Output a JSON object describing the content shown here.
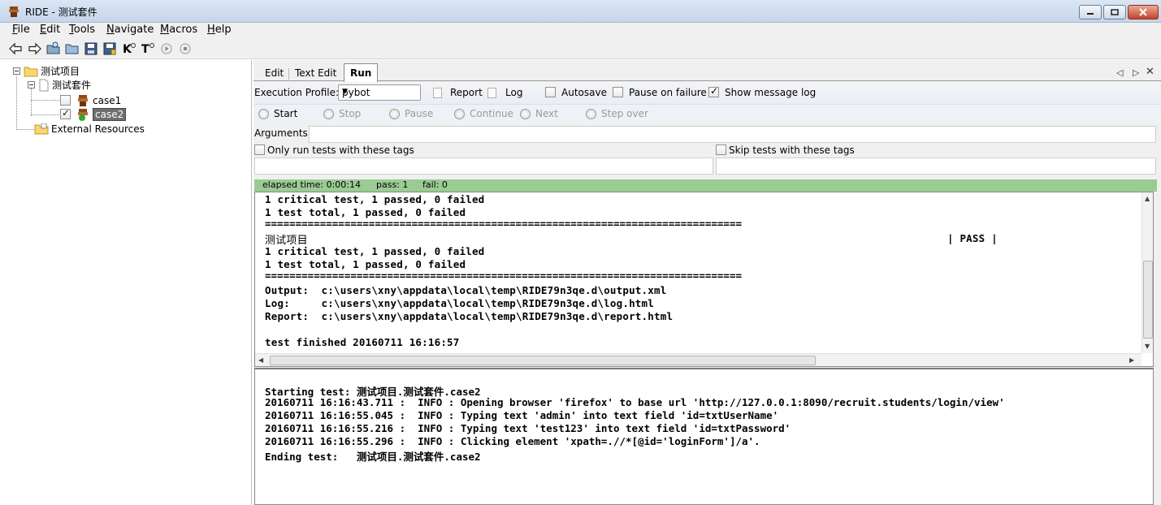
{
  "window": {
    "title": "RIDE - 测试套件",
    "icons": [
      "ride-app-icon",
      "minimize-icon",
      "maximize-icon",
      "close-icon"
    ]
  },
  "menu": [
    {
      "label": "File",
      "mnemonic": "F",
      "rest": "ile"
    },
    {
      "label": "Edit",
      "mnemonic": "E",
      "rest": "dit"
    },
    {
      "label": "Tools",
      "mnemonic": "T",
      "rest": "ools"
    },
    {
      "label": "Navigate",
      "mnemonic": "N",
      "rest": "avigate"
    },
    {
      "label": "Macros",
      "mnemonic": "M",
      "rest": "acros"
    },
    {
      "label": "Help",
      "mnemonic": "H",
      "rest": "elp"
    }
  ],
  "toolbar_icons": [
    "back-arrow-icon",
    "forward-arrow-icon",
    "open-suite-icon",
    "open-directory-icon",
    "save-icon",
    "save-all-icon",
    "search-keywords-icon",
    "search-tests-icon",
    "run-icon",
    "stop-icon"
  ],
  "tree": {
    "root": "测试项目",
    "suite": "测试套件",
    "cases": [
      {
        "name": "case1",
        "checked": false
      },
      {
        "name": "case2",
        "checked": true,
        "selected": true
      }
    ],
    "external": "External Resources"
  },
  "tabs": {
    "items": [
      "Edit",
      "Text Edit",
      "Run"
    ],
    "active": "Run"
  },
  "run_panel": {
    "profile_label": "Execution Profile:",
    "profile_value": "pybot",
    "report_label": "Report",
    "log_label": "Log",
    "autosave_label": "Autosave",
    "autosave_checked": false,
    "pause_label": "Pause on failure",
    "pause_checked": false,
    "show_log_label": "Show message log",
    "show_log_checked": true,
    "buttons": {
      "start": "Start",
      "stop": "Stop",
      "pause": "Pause",
      "continue": "Continue",
      "next": "Next",
      "step_over": "Step over"
    },
    "arguments_label": "Arguments:",
    "only_tags_label": "Only run tests with these tags",
    "skip_tags_label": "Skip tests with these tags"
  },
  "status": {
    "elapsed": "elapsed time: 0:00:14",
    "pass": "pass: 1",
    "fail": "fail: 0",
    "color": "#9acb93"
  },
  "output": {
    "line1": "1 critical test, 1 passed, 0 failed",
    "line2": "1 test total, 1 passed, 0 failed",
    "rule": "==============================================================================",
    "suite_name": "测试项目",
    "pass_marker": "| PASS |",
    "line3": "1 critical test, 1 passed, 0 failed",
    "line4": "1 test total, 1 passed, 0 failed",
    "output_line": "Output:  c:\\users\\xny\\appdata\\local\\temp\\RIDE79n3qe.d\\output.xml",
    "log_line": "Log:     c:\\users\\xny\\appdata\\local\\temp\\RIDE79n3qe.d\\log.html",
    "report_line": "Report:  c:\\users\\xny\\appdata\\local\\temp\\RIDE79n3qe.d\\report.html",
    "finished": "test finished 20160711 16:16:57"
  },
  "message_log": [
    "Starting test: 测试项目.测试套件.case2",
    "20160711 16:16:43.711 :  INFO : Opening browser 'firefox' to base url 'http://127.0.0.1:8090/recruit.students/login/view'",
    "20160711 16:16:55.045 :  INFO : Typing text 'admin' into text field 'id=txtUserName'",
    "20160711 16:16:55.216 :  INFO : Typing text 'test123' into text field 'id=txtPassword'",
    "20160711 16:16:55.296 :  INFO : Clicking element 'xpath=.//*[@id='loginForm']/a'.",
    "Ending test:   测试项目.测试套件.case2"
  ]
}
